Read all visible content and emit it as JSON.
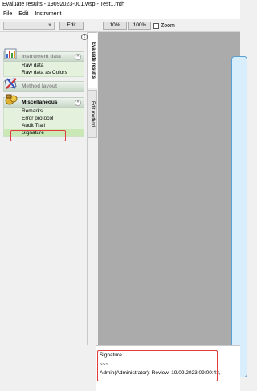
{
  "window": {
    "title": "Evaluate results - 19092023-001.wsp - Test1.mth"
  },
  "menu": [
    "File",
    "Edit",
    "Instrument"
  ],
  "toolbar": {
    "edit_label": "Edit",
    "zoom_10": "10%",
    "zoom_100": "100%",
    "zoom_checkbox_label": "Zoom"
  },
  "sidebar": {
    "groups": [
      {
        "label": "Instrument data",
        "items": [
          "Raw data",
          "Raw data as Colors"
        ]
      },
      {
        "label": "Method layout",
        "items": []
      },
      {
        "label": "Miscellaneous",
        "items": [
          "Remarks",
          "Error protocol",
          "Audit Trail",
          "Signature"
        ]
      }
    ]
  },
  "vertical_tabs": [
    "Evaluate results",
    "Edit method"
  ],
  "signature_panel": {
    "title": "Signature",
    "separator": "~~~",
    "entry": "Admin(Administrator): Review, 19.09.2023 09:00:43,"
  },
  "colors": {
    "highlight": "#e23b3b",
    "group_bg": "#e4f1dd",
    "canvas_bg": "#ababab",
    "accent_blue": "#5a9fd4"
  }
}
